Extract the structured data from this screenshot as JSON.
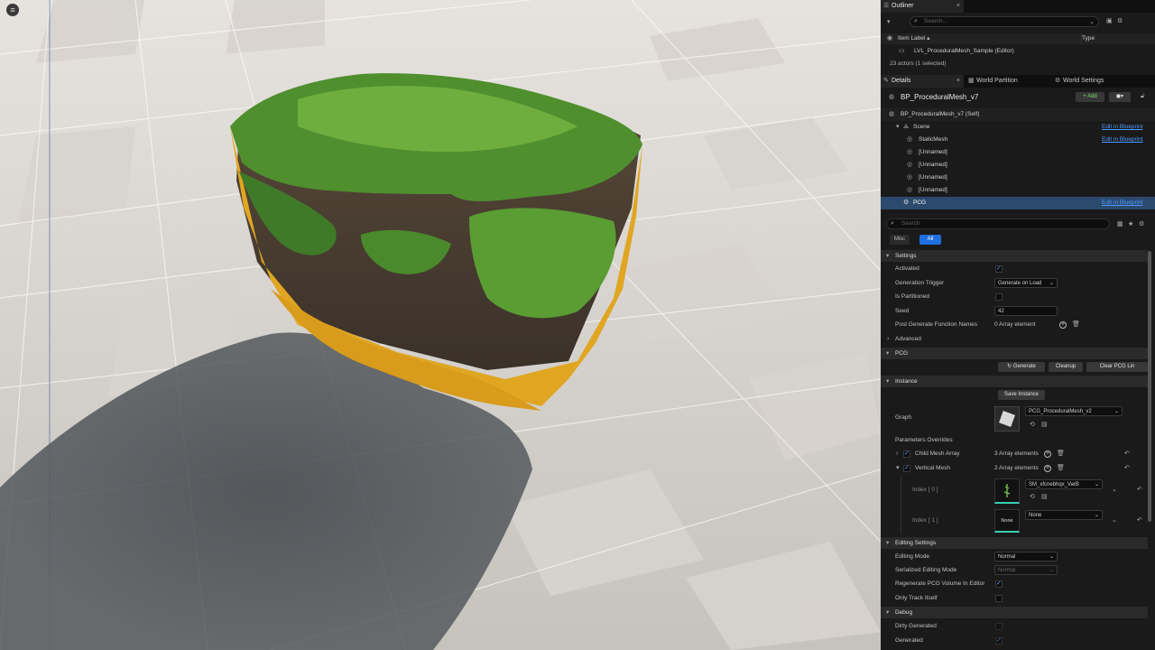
{
  "viewport": {
    "menu_icon": "hamburger-icon"
  },
  "outliner": {
    "tab_label": "Outliner",
    "search_placeholder": "Search...",
    "col_label": "Item Label",
    "col_type": "Type",
    "level_name": "LVL_ProceduralMesh_Sample (Editor)",
    "actor_count": "23 actors (1 selected)"
  },
  "tabs": {
    "details": "Details",
    "world_partition": "World Partition",
    "world_settings": "World Settings"
  },
  "details": {
    "actor_name": "BP_ProceduralMesh_v7",
    "add_label": "+ Add",
    "self_label": "BP_ProceduralMesh_v7 (Self)",
    "components": [
      {
        "label": "Scene",
        "link": "Edit in Blueprint"
      },
      {
        "label": "StaticMesh",
        "link": "Edit in Blueprint"
      },
      {
        "label": "[Unnamed]",
        "link": ""
      },
      {
        "label": "[Unnamed]",
        "link": ""
      },
      {
        "label": "[Unnamed]",
        "link": ""
      },
      {
        "label": "[Unnamed]",
        "link": ""
      },
      {
        "label": "PCG",
        "link": "Edit in Blueprint"
      }
    ],
    "search_placeholder": "Search",
    "filter_misc": "Misc",
    "filter_all": "All"
  },
  "settings": {
    "header": "Settings",
    "activated": "Activated",
    "generation_trigger": "Generation Trigger",
    "generation_trigger_value": "Generate on Load",
    "is_partitioned": "Is Partitioned",
    "seed": "Seed",
    "seed_value": "42",
    "post_generate": "Post Generate Function Names",
    "post_generate_value": "0 Array element",
    "advanced": "Advanced"
  },
  "pcg": {
    "header": "PCG",
    "generate": "Generate",
    "cleanup": "Cleanup",
    "clear_link": "Clear PCG Lin"
  },
  "instance": {
    "header": "Instance",
    "save_instance": "Save Instance",
    "graph": "Graph",
    "graph_value": "PCG_ProceduralMesh_v2",
    "param_overrides": "Parameters Overrides",
    "child_mesh_array": "Child Mesh Array",
    "child_mesh_value": "3 Array elements",
    "vertical_mesh": "Vertical Mesh",
    "vertical_mesh_value": "2 Array elements",
    "index0": "Index [ 0 ]",
    "index0_value": "SM_xfcnebhqx_VarB",
    "index1": "Index [ 1 ]",
    "index1_value": "None",
    "none_thumb": "None"
  },
  "editing": {
    "header": "Editing Settings",
    "editing_mode": "Editing Mode",
    "editing_mode_value": "Normal",
    "serialized_mode": "Serialized Editing Mode",
    "serialized_mode_value": "Normal",
    "regenerate": "Regenerate PCG Volume In Editor",
    "only_track": "Only Track Itself"
  },
  "debug": {
    "header": "Debug",
    "dirty_generated": "Dirty Generated",
    "generated": "Generated"
  },
  "colors": {
    "accent": "#1f6fe0",
    "link": "#4d9bff",
    "selected_row": "#2c4a6e"
  }
}
